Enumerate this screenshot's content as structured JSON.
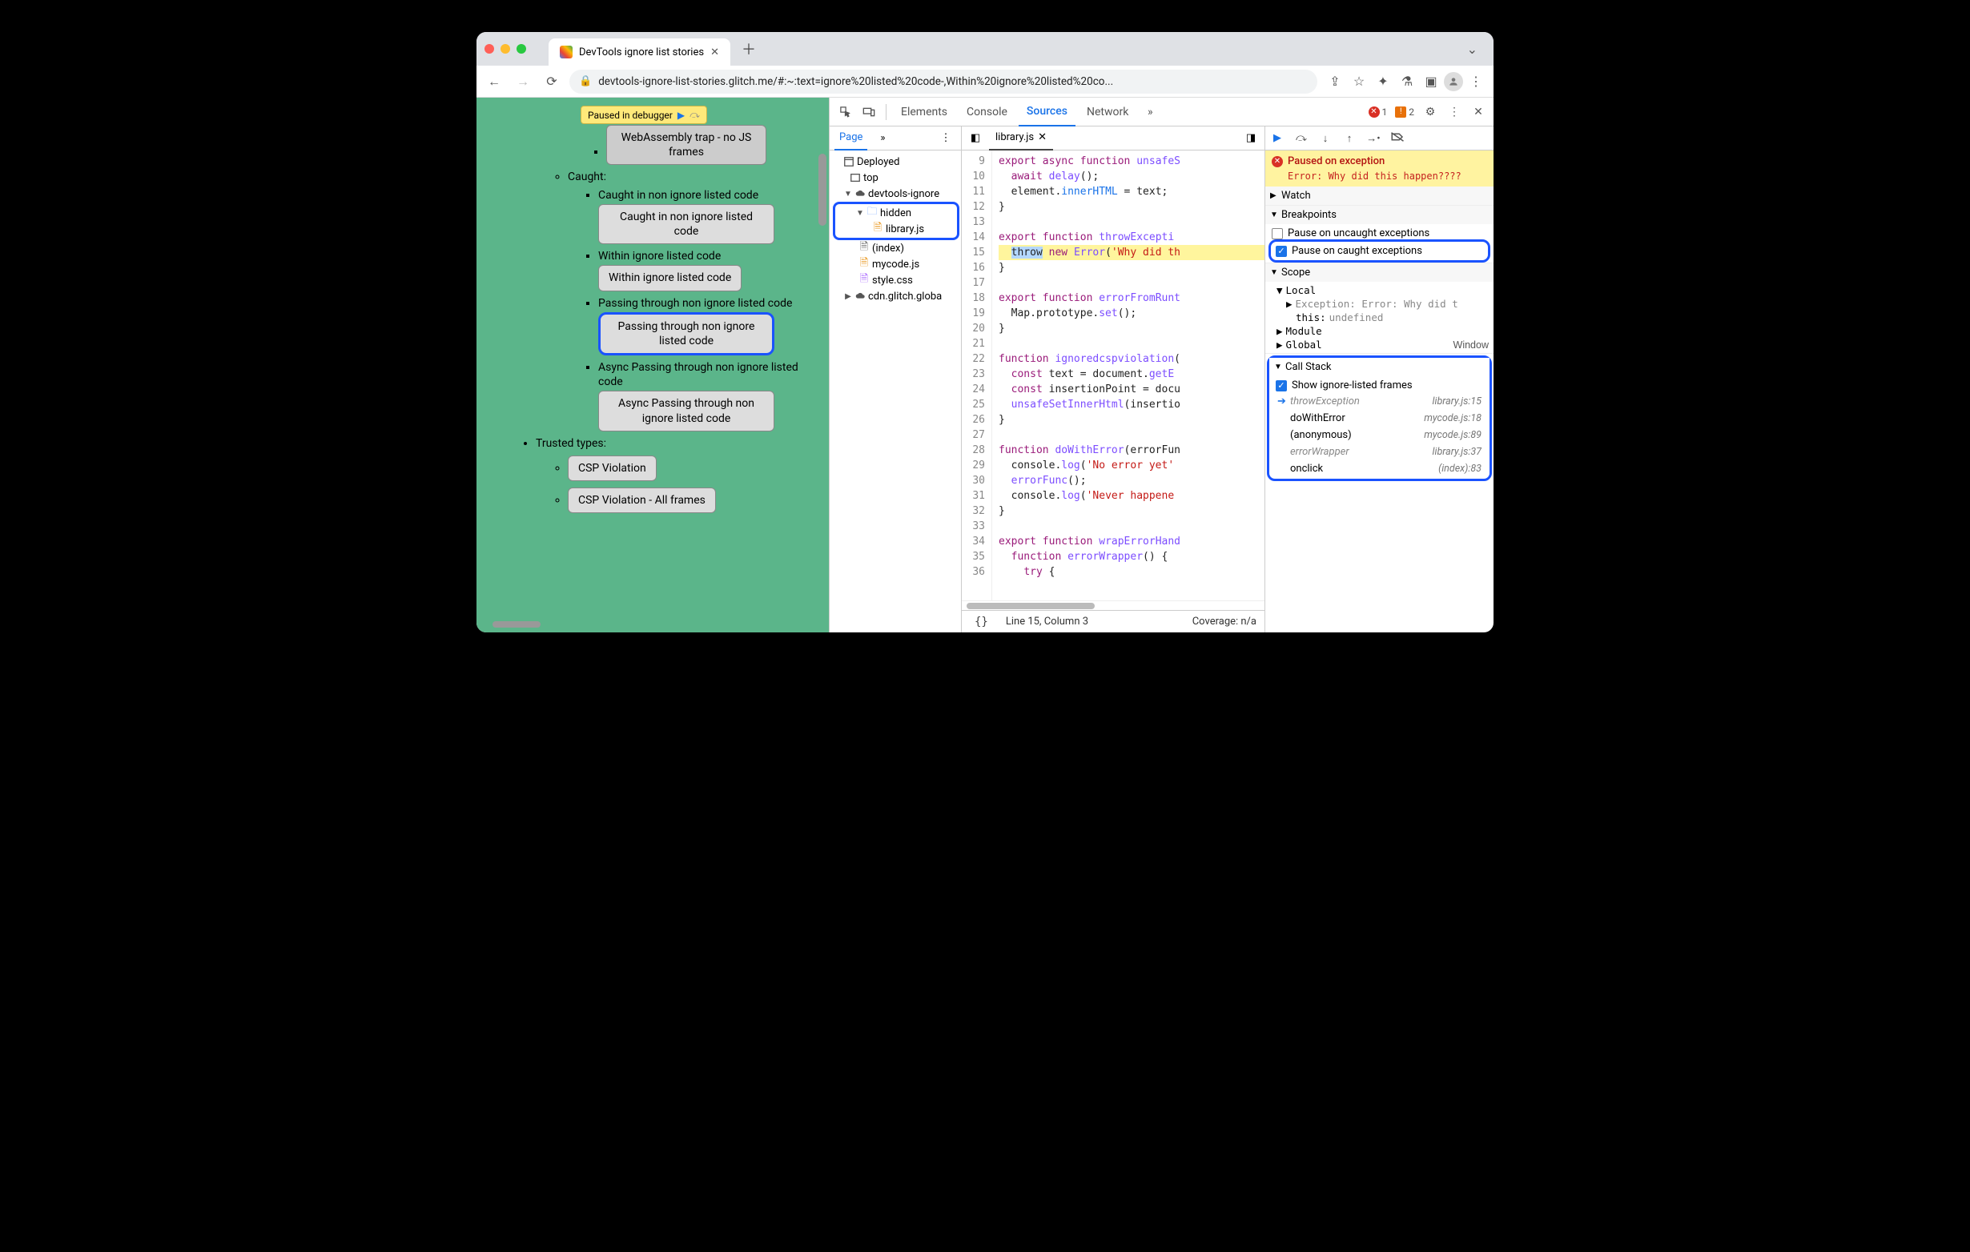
{
  "browser": {
    "tab_title": "DevTools ignore list stories",
    "url": "devtools-ignore-list-stories.glitch.me/#:~:text=ignore%20listed%20code-,Within%20ignore%20listed%20co..."
  },
  "paused_pill": "Paused in debugger",
  "page": {
    "top_button": "WebAssembly trap - no JS frames",
    "caught_label": "Caught:",
    "items": [
      {
        "t": "Caught in non ignore listed code",
        "b": "Caught in non ignore listed code"
      },
      {
        "t": "Within ignore listed code",
        "b": "Within ignore listed code"
      },
      {
        "t": "Passing through non ignore listed code",
        "b": "Passing through non ignore listed code",
        "hl": true
      },
      {
        "t": "Async Passing through non ignore listed code",
        "b": "Async Passing through non ignore listed code"
      }
    ],
    "trusted_label": "Trusted types:",
    "trusted": [
      "CSP Violation",
      "CSP Violation - All frames"
    ]
  },
  "devtools": {
    "tabs": [
      "Elements",
      "Console",
      "Sources",
      "Network"
    ],
    "active_tab": "Sources",
    "errors": "1",
    "warns": "2"
  },
  "navigator": {
    "tab": "Page",
    "tree": {
      "deployed": "Deployed",
      "top": "top",
      "origin": "devtools-ignore",
      "hidden_folder": "hidden",
      "hidden_file": "library.js",
      "index": "(index)",
      "mycode": "mycode.js",
      "style": "style.css",
      "cdn": "cdn.glitch.globa"
    }
  },
  "editor": {
    "file": "library.js",
    "first_line": 9,
    "gutter": [
      "9",
      "10",
      "11",
      "12",
      "13",
      "14",
      "15",
      "16",
      "17",
      "18",
      "19",
      "20",
      "21",
      "22",
      "23",
      "24",
      "25",
      "26",
      "27",
      "28",
      "29",
      "30",
      "31",
      "32",
      "33",
      "34",
      "35",
      "36"
    ],
    "status_line": "Line 15, Column 3",
    "status_cov": "Coverage: n/a"
  },
  "debugger": {
    "paused_title": "Paused on exception",
    "paused_msg": "Error: Why did this happen????",
    "sections": {
      "watch": "Watch",
      "bp": "Breakpoints",
      "scope": "Scope",
      "cs": "Call Stack"
    },
    "bp_uncaught": "Pause on uncaught exceptions",
    "bp_caught": "Pause on caught exceptions",
    "scope": {
      "local": "Local",
      "exc": "Exception: Error: Why did t",
      "this": "this:",
      "this_v": "undefined",
      "module": "Module",
      "global": "Global",
      "global_v": "Window"
    },
    "show_ign": "Show ignore-listed frames",
    "frames": [
      {
        "fn": "throwException",
        "loc": "library.js:15",
        "cur": true,
        "ign": true
      },
      {
        "fn": "doWithError",
        "loc": "mycode.js:18"
      },
      {
        "fn": "(anonymous)",
        "loc": "mycode.js:89"
      },
      {
        "fn": "errorWrapper",
        "loc": "library.js:37",
        "ign": true
      },
      {
        "fn": "onclick",
        "loc": "(index):83"
      }
    ]
  }
}
